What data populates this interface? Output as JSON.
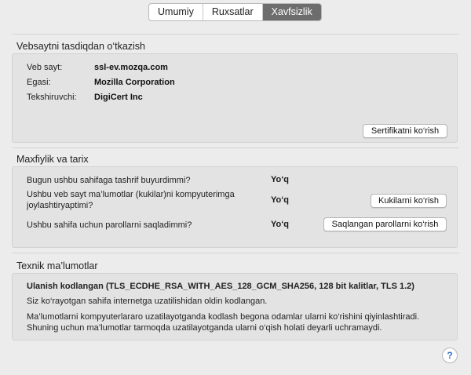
{
  "tabs": [
    {
      "label": "Umumiy",
      "active": false
    },
    {
      "label": "Ruxsatlar",
      "active": false
    },
    {
      "label": "Xavfsizlik",
      "active": true
    }
  ],
  "verification": {
    "title": "Vebsaytni tasdiqdan o‘tkazish",
    "website_label": "Veb sayt:",
    "website_value": "ssl-ev.mozqa.com",
    "owner_label": "Egasi:",
    "owner_value": "Mozilla Corporation",
    "verifier_label": "Tekshiruvchi:",
    "verifier_value": "DigiCert Inc",
    "view_cert_button": "Sertifikatni ko‘rish"
  },
  "privacy": {
    "title": "Maxfiylik va tarix",
    "q1": "Bugun ushbu sahifaga tashrif buyurdimmi?",
    "a1": "Yo‘q",
    "q2_line1": "Ushbu veb sayt ma’lumotlar (kukilar)ni kompyuterimga",
    "q2_line2": "joylashtiryaptimi?",
    "a2": "Yo‘q",
    "cookies_button": "Kukilarni ko‘rish",
    "q3": "Ushbu sahifa uchun parollarni saqladimmi?",
    "a3": "Yo‘q",
    "passwords_button": "Saqlangan parollarni ko‘rish"
  },
  "technical": {
    "title": "Texnik ma’lumotlar",
    "connection": "Ulanish kodlangan (TLS_ECDHE_RSA_WITH_AES_128_GCM_SHA256, 128 bit kalitlar, TLS 1.2)",
    "line1": "Siz ko‘rayotgan sahifa internetga uzatilishidan oldin kodlangan.",
    "line2": "Ma’lumotlarni kompyuterlararo uzatilayotganda kodlash begona odamlar ularni ko‘rishini qiyinlashtiradi.",
    "line3": "Shuning uchun ma’lumotlar tarmoqda uzatilayotganda ularni o‘qish holati deyarli uchramaydi."
  },
  "help": {
    "label": "?"
  }
}
